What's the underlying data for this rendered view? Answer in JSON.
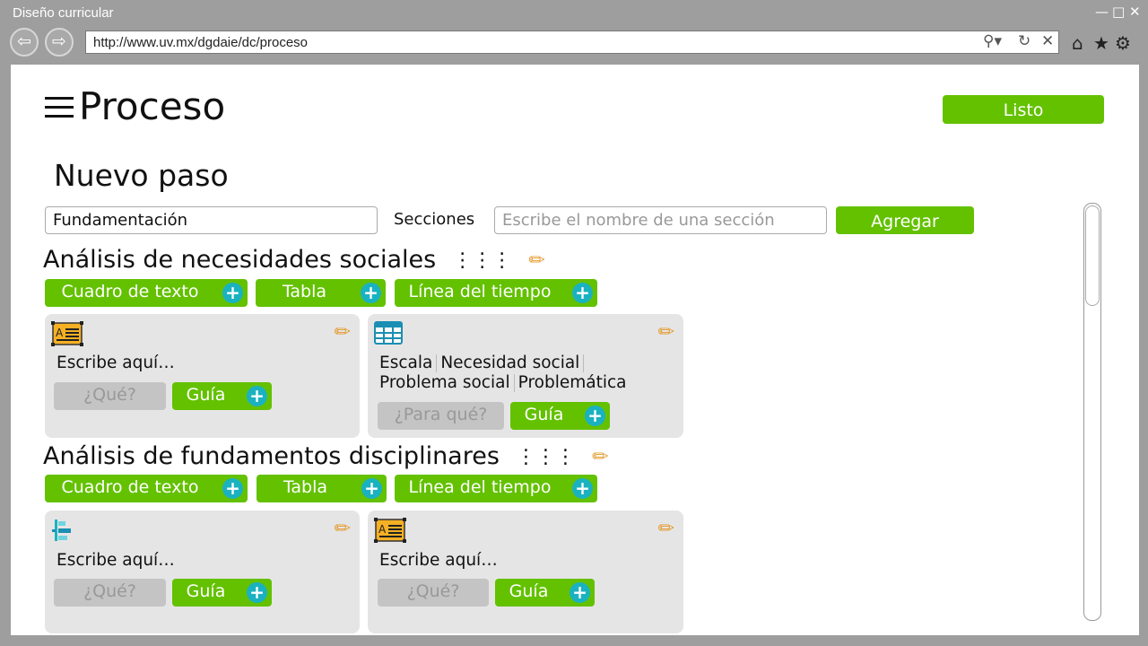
{
  "window": {
    "title": "Diseño curricular",
    "minimize": "—",
    "maximize": "□",
    "close": "✕"
  },
  "browser": {
    "back": "⇦",
    "forward": "⇨",
    "url": "http://www.uv.mx/dgdaie/dc/proceso",
    "search_glyph": "⚲▾",
    "refresh_glyph": "↻",
    "stop_glyph": "✕",
    "home_glyph": "⌂",
    "favorites_glyph": "★",
    "settings_glyph": "⚙"
  },
  "header": {
    "title": "Proceso",
    "done_label": "Listo"
  },
  "new_step": {
    "title": "Nuevo paso",
    "step_value": "Fundamentación",
    "sections_label": "Secciones",
    "section_placeholder": "Escribe el nombre de una sección",
    "add_label": "Agregar"
  },
  "sections": [
    {
      "title": "Análisis de necesidades sociales",
      "add_buttons": [
        "Cuadro de texto",
        "Tabla",
        "Línea del tiempo"
      ],
      "cards": [
        {
          "type": "text-box",
          "text": "Escribe aquí…",
          "question": "¿Qué?",
          "guide": "Guía"
        },
        {
          "type": "table",
          "columns_row1": [
            "Escala",
            "Necesidad social"
          ],
          "columns_row2": [
            "Problema social",
            "Problemática"
          ],
          "question": "¿Para qué?",
          "guide": "Guía"
        }
      ]
    },
    {
      "title": "Análisis de fundamentos disciplinares",
      "add_buttons": [
        "Cuadro de texto",
        "Tabla",
        "Línea del tiempo"
      ],
      "cards": [
        {
          "type": "timeline",
          "text": "Escribe aquí…",
          "question": "¿Qué?",
          "guide": "Guía"
        },
        {
          "type": "text-box",
          "text": "Escribe aquí…",
          "question": "¿Qué?",
          "guide": "Guía"
        }
      ]
    }
  ],
  "icons": {
    "plus": "+",
    "pencil": "✏",
    "reorder": "⋮⋮⋮"
  },
  "colors": {
    "accent_green": "#63c100",
    "plus_teal": "#1ab2c0",
    "card_bg": "#e6e5e6",
    "chrome_gray": "#9e9e9e"
  }
}
